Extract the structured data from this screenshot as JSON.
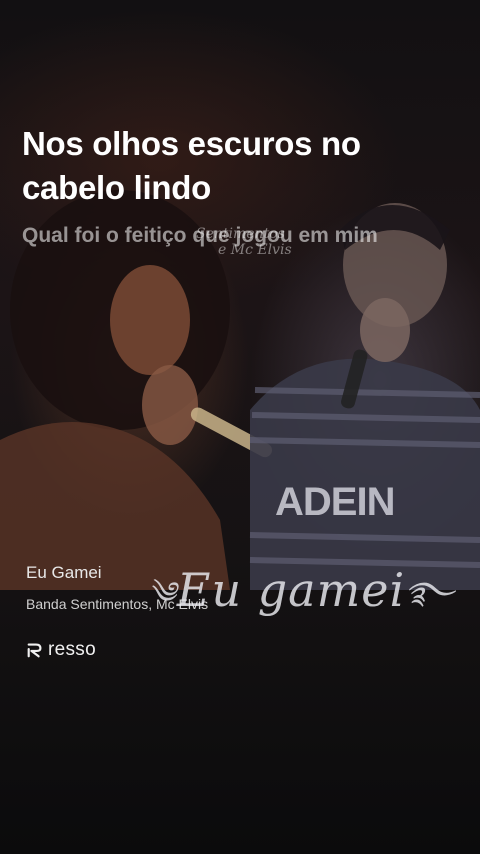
{
  "lyrics": {
    "current": "Nos olhos escuros no cabelo lindo",
    "next": "Qual foi o feitiço que jogou em mim"
  },
  "image_watermark": {
    "line1": "Sentimentos",
    "line2": "e Mc Elvis"
  },
  "song": {
    "title": "Eu Gamei",
    "artists": "Banda Sentimentos, Mc Elvis"
  },
  "logo_art": {
    "text": "Eu gamei"
  },
  "brand": {
    "name": "resso",
    "icon": "resso-logo-icon"
  },
  "colors": {
    "background": "#0b0b0d",
    "lyric_current": "#ffffff",
    "lyric_next": "#8c8c8c"
  }
}
